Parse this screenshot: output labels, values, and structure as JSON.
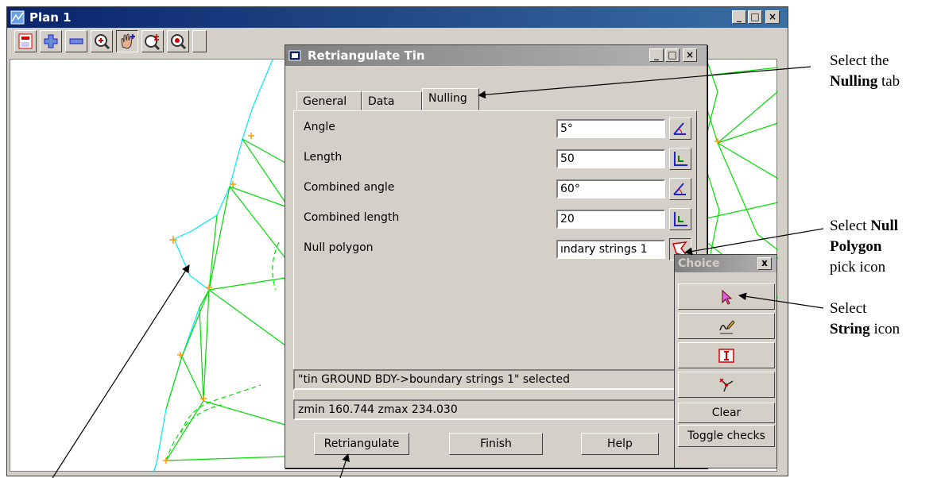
{
  "plan_window": {
    "title": "Plan 1",
    "toolbar_icons": [
      "save-icon",
      "zoom-in-plus-icon",
      "zoom-out-minus-icon",
      "zoom-magnify-icon",
      "pan-hand-icon",
      "zoom-plus-minus-icon",
      "zoom-target-icon",
      "more-icon"
    ]
  },
  "dialog": {
    "title": "Retriangulate Tin",
    "tabs": [
      {
        "label": "General"
      },
      {
        "label": "Data"
      },
      {
        "label": "Nulling"
      }
    ],
    "rows": [
      {
        "label": "Angle",
        "value": "5°"
      },
      {
        "label": "Length",
        "value": "50"
      },
      {
        "label": "Combined angle",
        "value": "60°"
      },
      {
        "label": "Combined length",
        "value": "20"
      },
      {
        "label": "Null polygon",
        "value": "ındary strings 1"
      }
    ],
    "status1": "\"tin GROUND BDY->boundary strings 1\" selected",
    "status2": "zmin 160.744 zmax 234.030",
    "buttons": {
      "retriangulate": "Retriangulate",
      "finish": "Finish",
      "help": "Help"
    }
  },
  "choice": {
    "title": "Choice",
    "close": "x",
    "clear": "Clear",
    "toggle": "Toggle checks"
  },
  "annotations": {
    "a1_pre": "Select the",
    "a1_bold": "Nulling",
    "a1_post": "tab",
    "a2_pre": "Select",
    "a2_bold1": "Null",
    "a2_bold2": "Polygon",
    "a2_post": "pick icon",
    "a3_pre": "Select",
    "a3_bold": "String",
    "a3_post": "icon"
  },
  "colors": {
    "active_title": "#0a246a",
    "tin_green": "#00dd00",
    "boundary_cyan": "#00e5ff",
    "point_orange": "#ff9900"
  }
}
